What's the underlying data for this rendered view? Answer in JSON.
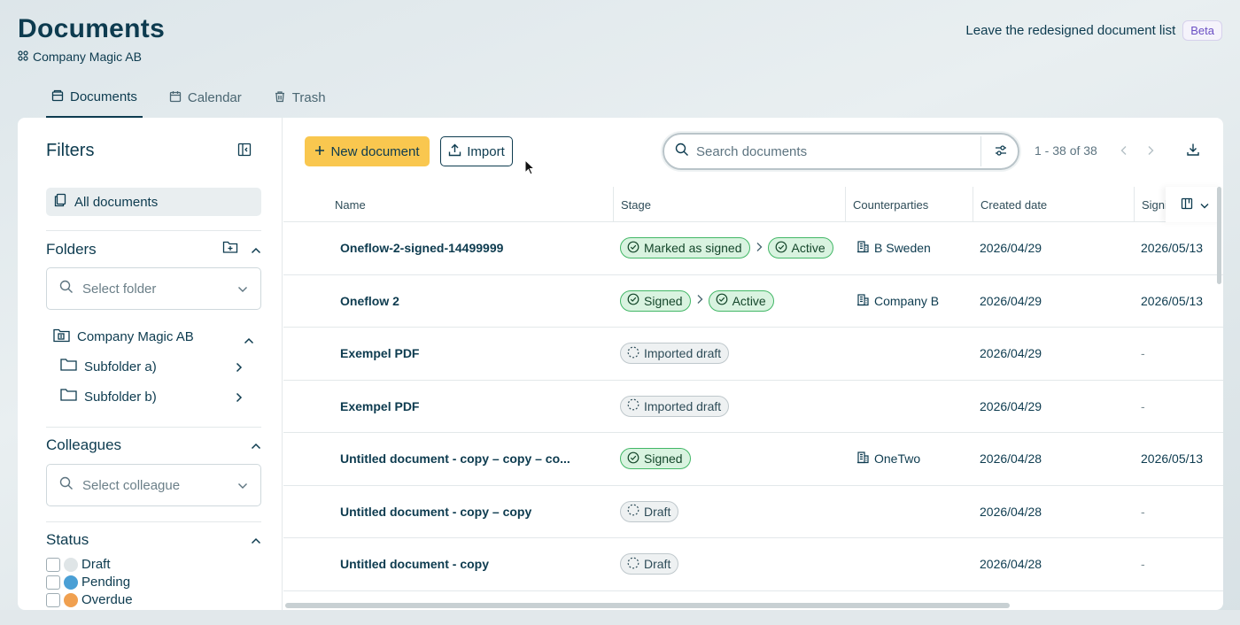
{
  "header": {
    "title": "Documents",
    "company": "Company Magic AB",
    "leave_text": "Leave the redesigned document list",
    "beta_label": "Beta"
  },
  "tabs": [
    {
      "label": "Documents",
      "icon": "documents-icon",
      "active": true
    },
    {
      "label": "Calendar",
      "icon": "calendar-icon",
      "active": false
    },
    {
      "label": "Trash",
      "icon": "trash-icon",
      "active": false
    }
  ],
  "sidebar": {
    "title": "Filters",
    "all_documents": "All documents",
    "folders": {
      "title": "Folders",
      "placeholder": "Select folder",
      "root": "Company Magic AB",
      "subfolders": [
        "Subfolder a)",
        "Subfolder b)"
      ]
    },
    "colleagues": {
      "title": "Colleagues",
      "placeholder": "Select colleague"
    },
    "status": {
      "title": "Status",
      "items": [
        {
          "label": "Draft",
          "color": "#dfe5e7"
        },
        {
          "label": "Pending",
          "color": "#4a9fd5"
        },
        {
          "label": "Overdue",
          "color": "#f0a050"
        }
      ]
    }
  },
  "toolbar": {
    "new_document": "New document",
    "import": "Import",
    "search_placeholder": "Search documents",
    "pager": "1 - 38 of 38"
  },
  "table": {
    "columns": [
      "Name",
      "Stage",
      "Counterparties",
      "Created date",
      "Signi"
    ],
    "rows": [
      {
        "name": "Oneflow-2-signed-14499999",
        "stages": [
          {
            "label": "Marked as signed",
            "kind": "signed"
          },
          {
            "label": "Active",
            "kind": "signed"
          }
        ],
        "counterparty": "B Sweden",
        "created": "2026/04/29",
        "signed": "2026/05/13"
      },
      {
        "name": "Oneflow 2",
        "stages": [
          {
            "label": "Signed",
            "kind": "signed"
          },
          {
            "label": "Active",
            "kind": "signed"
          }
        ],
        "counterparty": "Company B",
        "created": "2026/04/29",
        "signed": "2026/05/13"
      },
      {
        "name": "Exempel PDF",
        "stages": [
          {
            "label": "Imported draft",
            "kind": "draft"
          }
        ],
        "counterparty": "",
        "created": "2026/04/29",
        "signed": "-"
      },
      {
        "name": "Exempel PDF",
        "stages": [
          {
            "label": "Imported draft",
            "kind": "draft"
          }
        ],
        "counterparty": "",
        "created": "2026/04/29",
        "signed": "-"
      },
      {
        "name": "Untitled document - copy – copy – co...",
        "stages": [
          {
            "label": "Signed",
            "kind": "signed"
          }
        ],
        "counterparty": "OneTwo",
        "created": "2026/04/28",
        "signed": "2026/05/13"
      },
      {
        "name": "Untitled document - copy – copy",
        "stages": [
          {
            "label": "Draft",
            "kind": "draft"
          }
        ],
        "counterparty": "",
        "created": "2026/04/28",
        "signed": "-"
      },
      {
        "name": "Untitled document - copy",
        "stages": [
          {
            "label": "Draft",
            "kind": "draft"
          }
        ],
        "counterparty": "",
        "created": "2026/04/28",
        "signed": "-"
      }
    ]
  },
  "colors": {
    "accent": "#f9c74f",
    "primary_text": "#0d3b4f",
    "signed_bg": "#d9f3e0",
    "signed_border": "#42b766",
    "beta": "#6b4fc4"
  }
}
